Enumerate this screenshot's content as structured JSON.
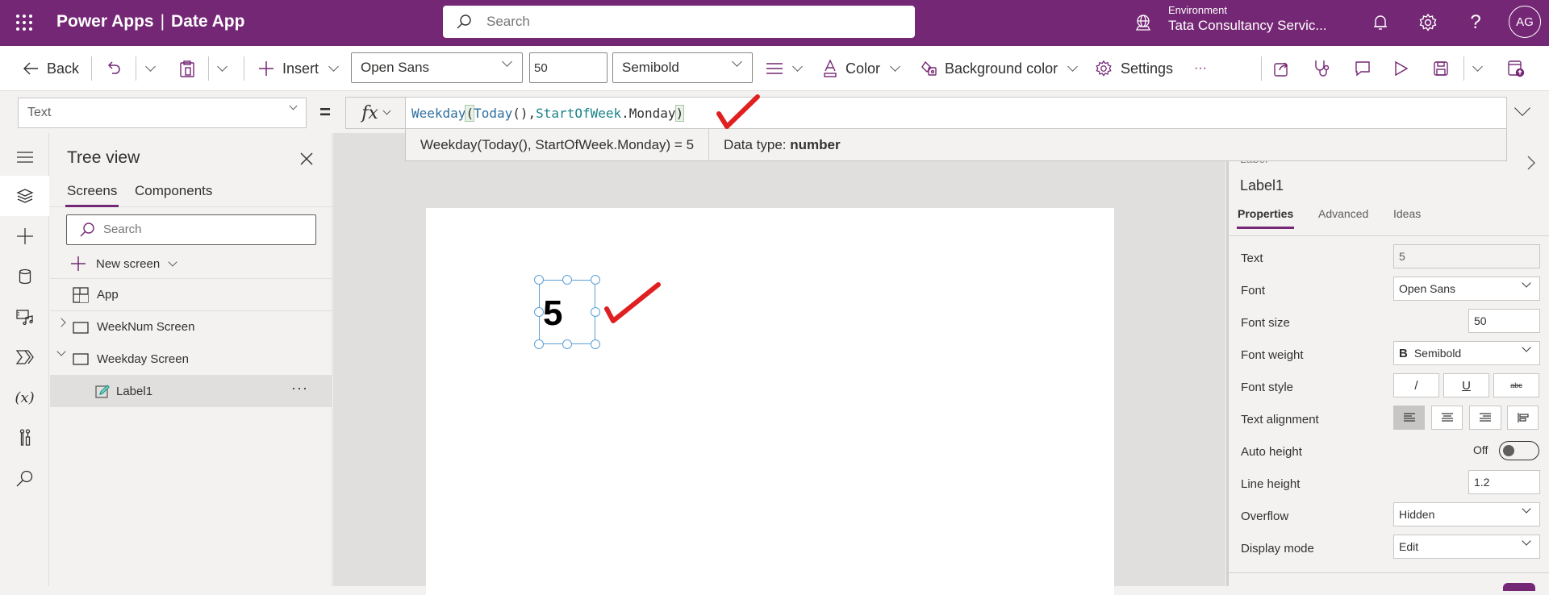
{
  "header": {
    "app_name": "Power Apps",
    "separator": "|",
    "app_title": "Date App",
    "search_placeholder": "Search",
    "environment_label": "Environment",
    "environment_value": "Tata Consultancy Servic...",
    "avatar_initials": "AG",
    "brand_color": "#742774"
  },
  "commandbar": {
    "back_label": "Back",
    "insert_label": "Insert",
    "font_value": "Open Sans",
    "font_size_value": "50",
    "font_weight_value": "Semibold",
    "color_label": "Color",
    "background_color_label": "Background color",
    "settings_label": "Settings",
    "more_label": "···"
  },
  "formula_bar": {
    "property": "Text",
    "equals": "=",
    "fx": "fx",
    "formula_parts": {
      "fn1": "Weekday",
      "p1": "(",
      "fn2": "Today",
      "p2": "(), ",
      "enum": "StartOfWeek",
      "dot": ".",
      "member": "Monday",
      "p3": ")"
    },
    "eval_expression": "Weekday(Today(), StartOfWeek.Monday)  =  5",
    "data_type_label": "Data type:",
    "data_type_value": "number"
  },
  "tree_view": {
    "title": "Tree view",
    "tabs": [
      "Screens",
      "Components"
    ],
    "search_placeholder": "Search",
    "new_screen_label": "New screen",
    "items": [
      {
        "label": "App",
        "type": "app"
      },
      {
        "label": "WeekNum Screen",
        "type": "screen",
        "expanded": false
      },
      {
        "label": "Weekday Screen",
        "type": "screen",
        "expanded": true
      },
      {
        "label": "Label1",
        "type": "label",
        "selected": true
      }
    ],
    "more_label": "···"
  },
  "canvas": {
    "label_value": "5"
  },
  "properties": {
    "partial_header": "Label",
    "control_name": "Label1",
    "tabs": [
      "Properties",
      "Advanced",
      "Ideas"
    ],
    "rows": {
      "text": {
        "label": "Text",
        "value": "5"
      },
      "font": {
        "label": "Font",
        "value": "Open Sans"
      },
      "font_size": {
        "label": "Font size",
        "value": "50"
      },
      "font_weight": {
        "label": "Font weight",
        "value": "Semibold",
        "icon": "B"
      },
      "font_style": {
        "label": "Font style",
        "italic": "/",
        "underline": "U",
        "strike": "abc"
      },
      "text_alignment": {
        "label": "Text alignment",
        "selected": "left"
      },
      "auto_height": {
        "label": "Auto height",
        "state": "Off"
      },
      "line_height": {
        "label": "Line height",
        "value": "1.2"
      },
      "overflow": {
        "label": "Overflow",
        "value": "Hidden"
      },
      "display_mode": {
        "label": "Display mode",
        "value": "Edit"
      }
    }
  },
  "annotations": {
    "checkmark_color": "#e02020"
  }
}
